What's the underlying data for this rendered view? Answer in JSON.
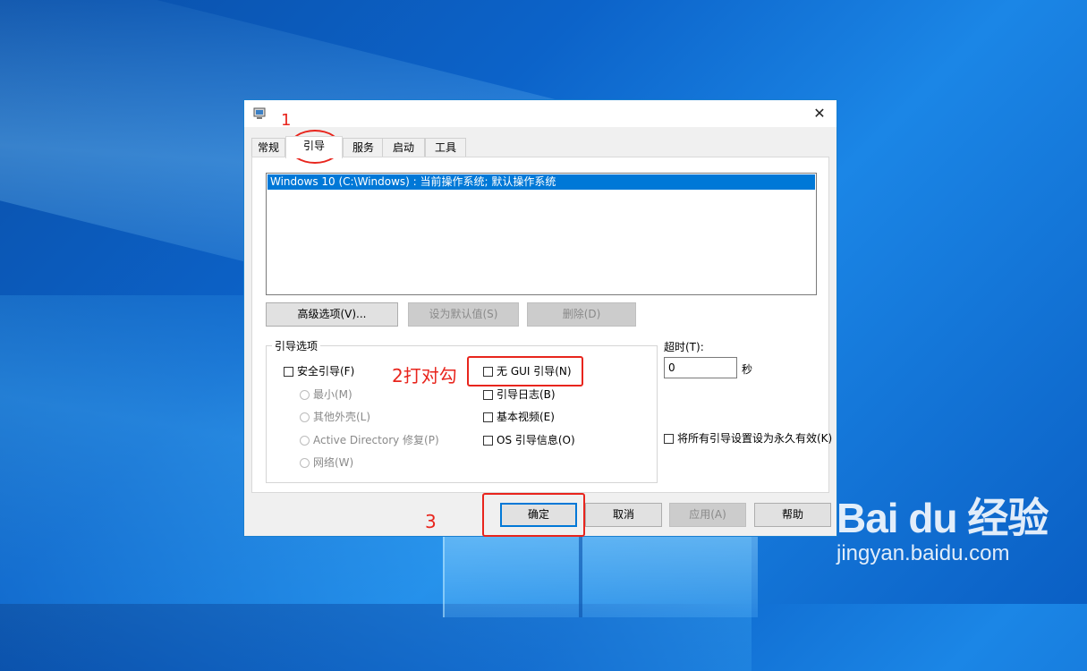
{
  "dialog": {
    "close_glyph": "✕",
    "tabs": [
      "常规",
      "引导",
      "服务",
      "启动",
      "工具"
    ],
    "active_tab": "引导",
    "os_list": [
      "Windows 10 (C:\\Windows) : 当前操作系统; 默认操作系统"
    ],
    "buttons": {
      "advanced": "高级选项(V)...",
      "set_default": "设为默认值(S)",
      "delete": "删除(D)"
    },
    "boot_options": {
      "title": "引导选项",
      "safe_boot": "安全引导(F)",
      "minimal": "最小(M)",
      "alternate_shell": "其他外壳(L)",
      "ad_repair": "Active Directory 修复(P)",
      "network": "网络(W)",
      "no_gui_boot": "无 GUI 引导(N)",
      "boot_log": "引导日志(B)",
      "base_video": "基本视频(E)",
      "os_boot_info": "OS 引导信息(O)"
    },
    "timeout": {
      "label": "超时(T):",
      "value": "0",
      "unit": "秒"
    },
    "make_permanent": "将所有引导设置设为永久有效(K)",
    "footer": {
      "ok": "确定",
      "cancel": "取消",
      "apply": "应用(A)",
      "help": "帮助"
    }
  },
  "annotations": {
    "step1": "1",
    "step2": "2打对勾",
    "step3": "3",
    "color": "#e8251d"
  },
  "watermark": {
    "logo": "Bai du 经验",
    "url": "jingyan.baidu.com"
  }
}
